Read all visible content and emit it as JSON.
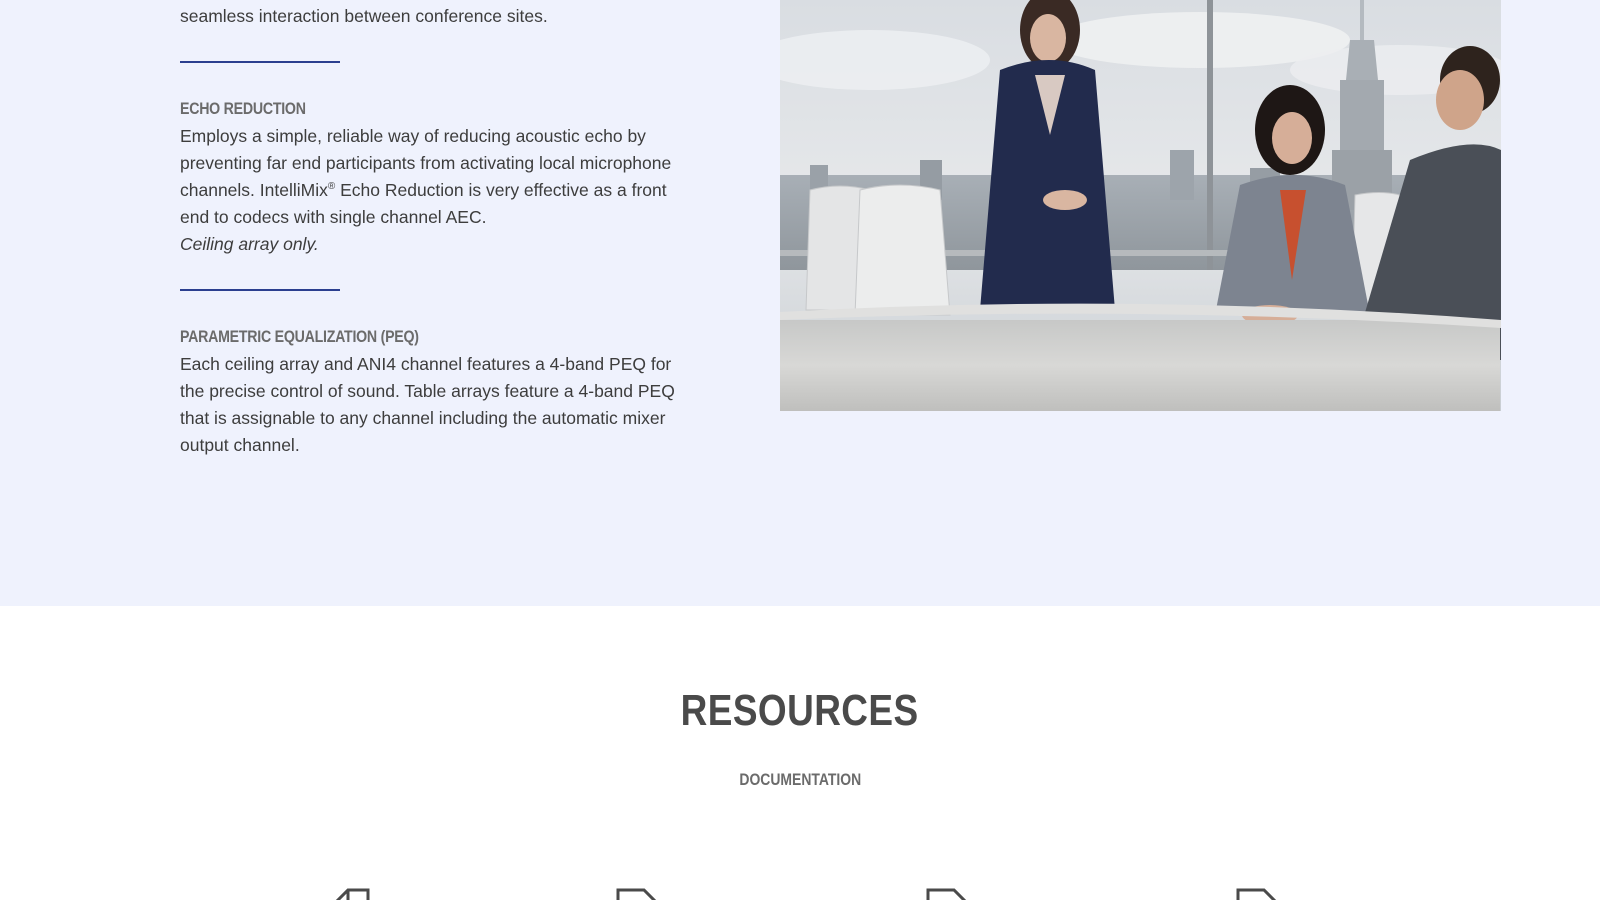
{
  "features": {
    "intro_tail": "transmission. This yields improved clarity, intelligibility and seamless interaction between conference sites.",
    "echo": {
      "heading": "ECHO REDUCTION",
      "text_before_mark": "Employs a simple, reliable way of reducing acoustic echo by preventing far end participants from activating local microphone channels. IntelliMix",
      "registered_mark": "®",
      "text_after_mark": " Echo Reduction is very effective as a front end to codecs with single channel AEC.",
      "note": "Ceiling array only."
    },
    "peq": {
      "heading": "PARAMETRIC EQUALIZATION (PEQ)",
      "text": "Each ceiling array and ANI4 channel features a 4-band PEQ for the precise control of sound. Table arrays feature a 4-band PEQ that is assignable to any channel including the automatic mixer output channel."
    },
    "accent_color": "#2b3f8f",
    "background_color": "#eff2fd"
  },
  "resources": {
    "title": "RESOURCES",
    "subtitle": "DOCUMENTATION",
    "documents": [
      {
        "icon": "document-icon"
      },
      {
        "icon": "document-icon"
      },
      {
        "icon": "document-icon"
      },
      {
        "icon": "document-icon"
      }
    ]
  }
}
